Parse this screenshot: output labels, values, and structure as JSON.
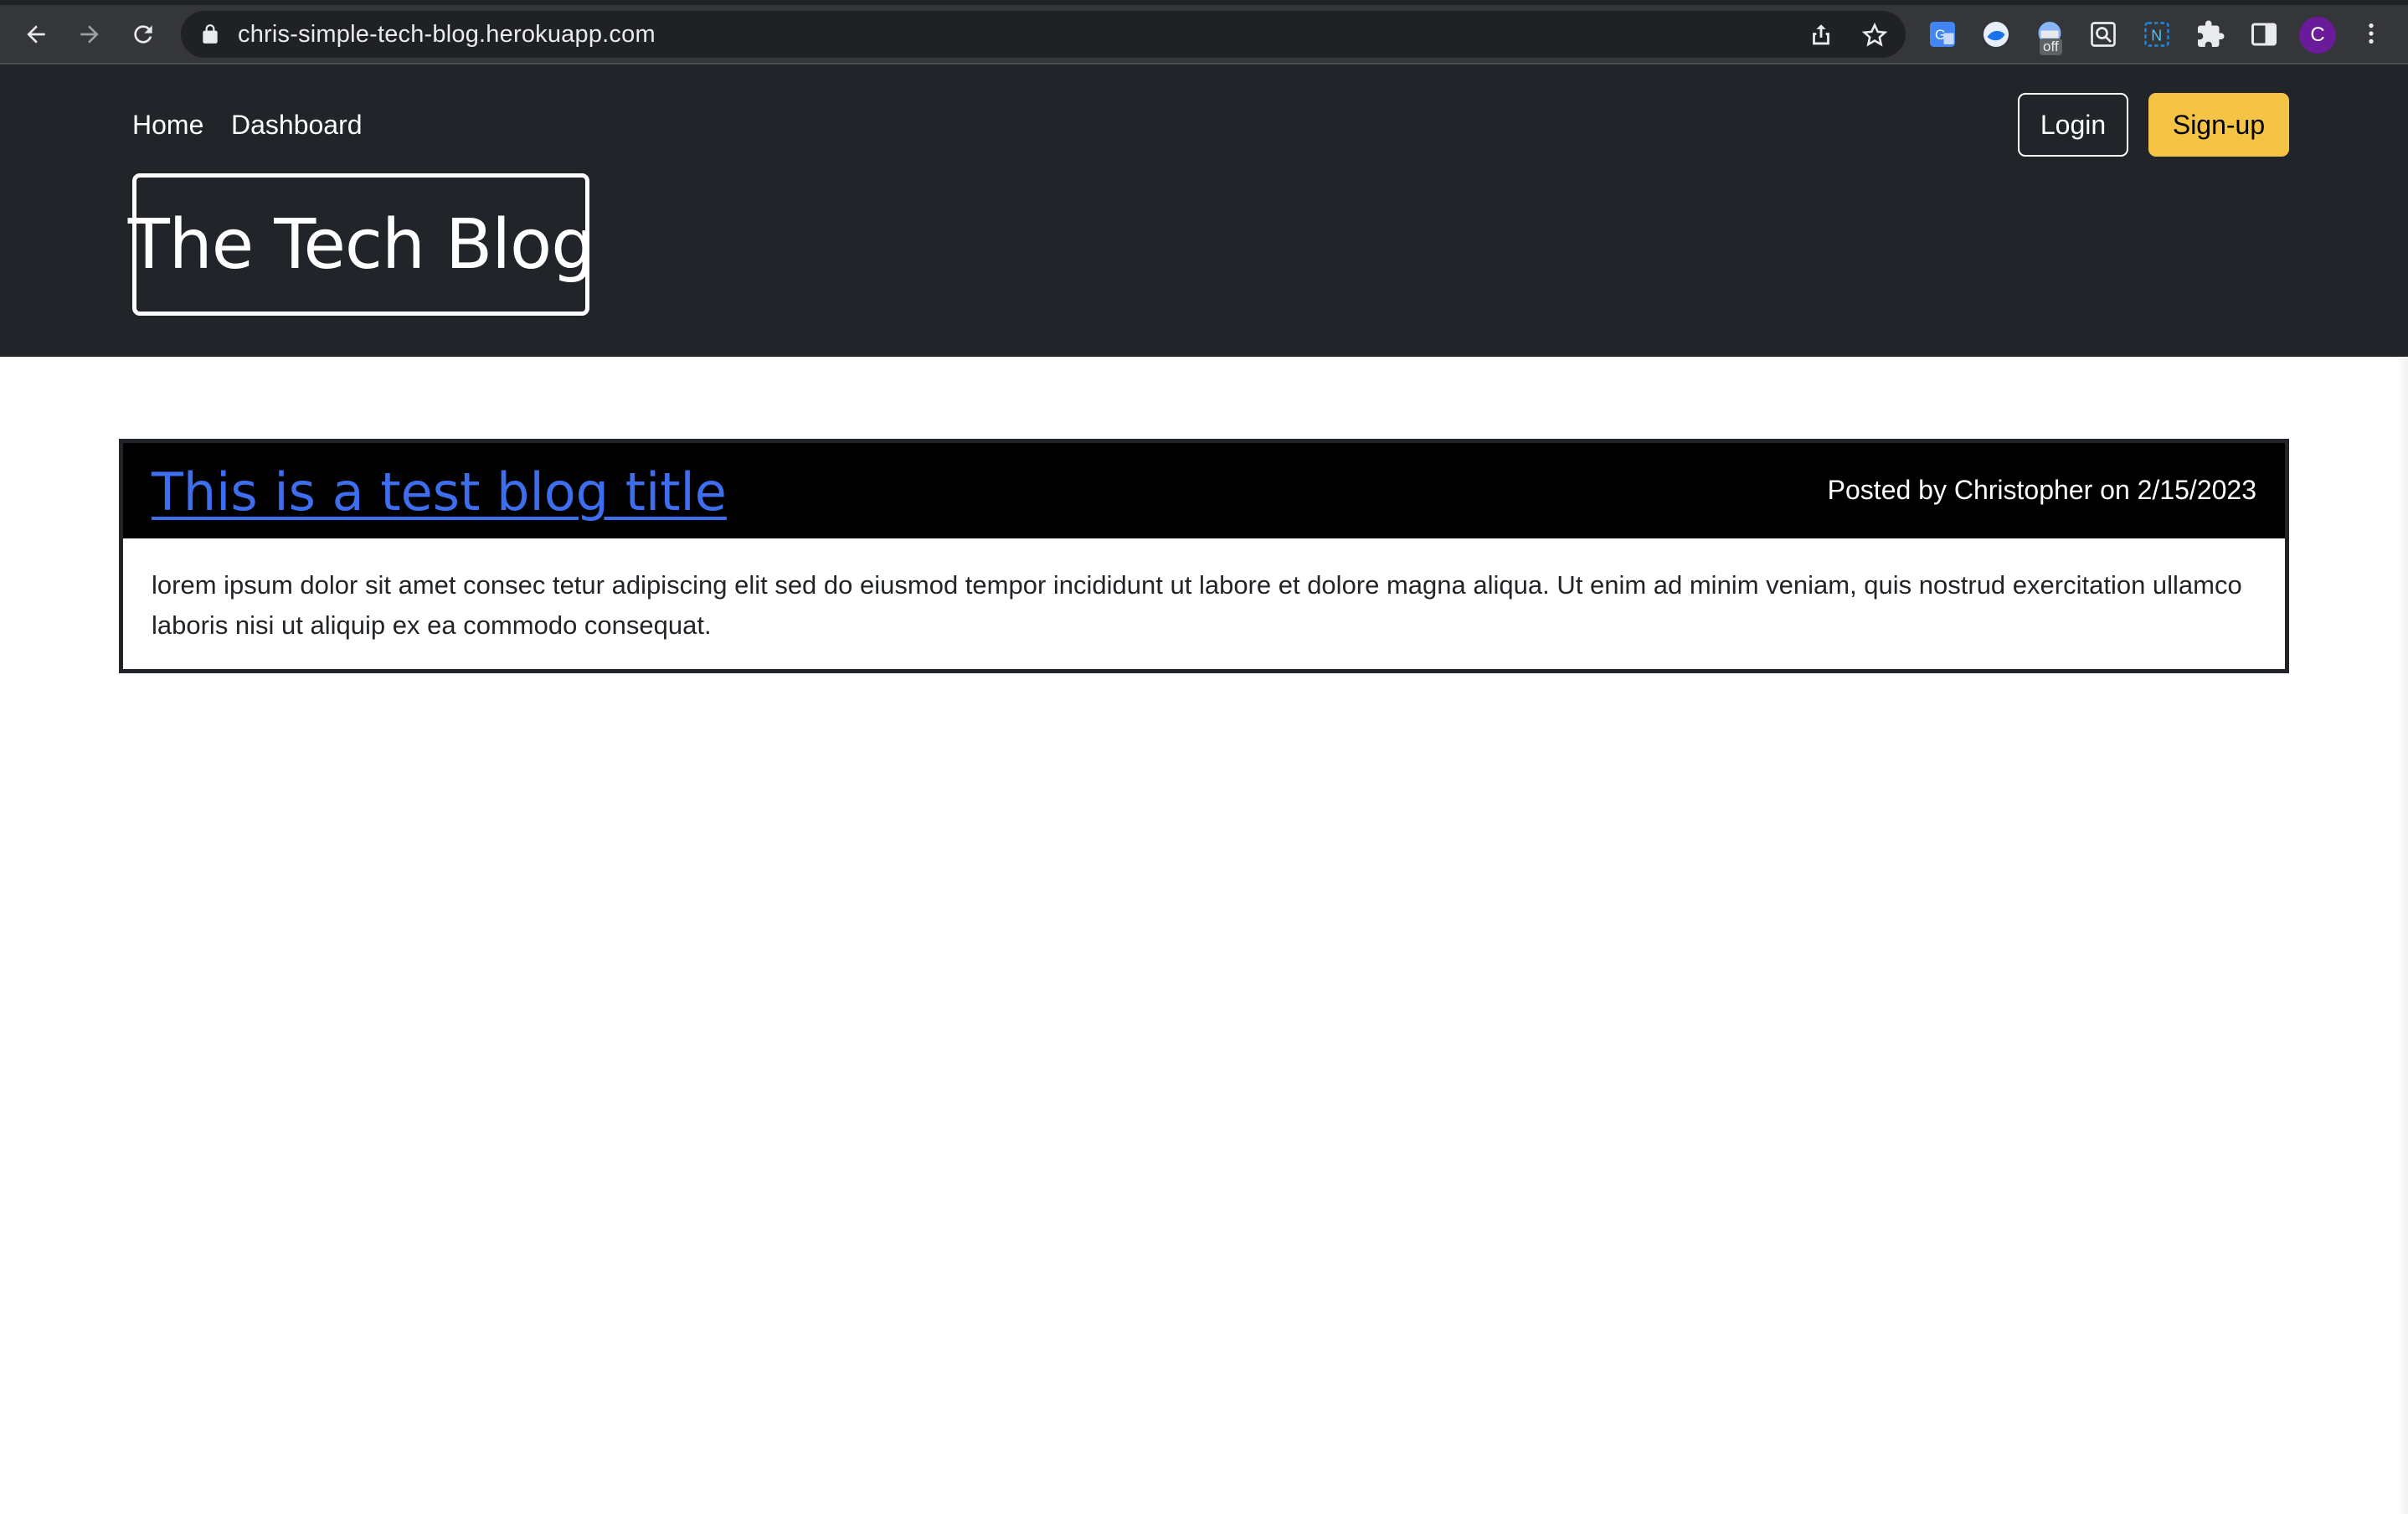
{
  "browser": {
    "url": "chris-simple-tech-blog.herokuapp.com",
    "extension_badge": "off",
    "profile_initial": "C",
    "icons": [
      "back-icon",
      "forward-icon",
      "reload-icon",
      "lock-icon",
      "share-icon",
      "star-icon",
      "translate-icon",
      "extension-icon",
      "extension-icon",
      "zoom-extension-icon",
      "notion-icon",
      "puzzle-icon",
      "side-panel-icon",
      "menu-icon"
    ]
  },
  "nav": {
    "home": "Home",
    "dashboard": "Dashboard",
    "login": "Login",
    "signup": "Sign-up"
  },
  "brand": {
    "title": "The Tech Blog"
  },
  "posts": [
    {
      "title": "This is a test blog title",
      "meta": "Posted by Christopher on 2/15/2023",
      "body": "lorem ipsum dolor sit amet consec tetur adipiscing elit sed do eiusmod tempor incididunt ut labore et dolore magna aliqua. Ut enim ad minim veniam, quis nostrud exercitation ullamco laboris nisi ut aliquip ex ea commodo consequat."
    }
  ],
  "colors": {
    "header_bg": "#212529",
    "signup_bg": "#f6c444",
    "link": "#3d6ef0",
    "post_header_bg": "#000000"
  }
}
